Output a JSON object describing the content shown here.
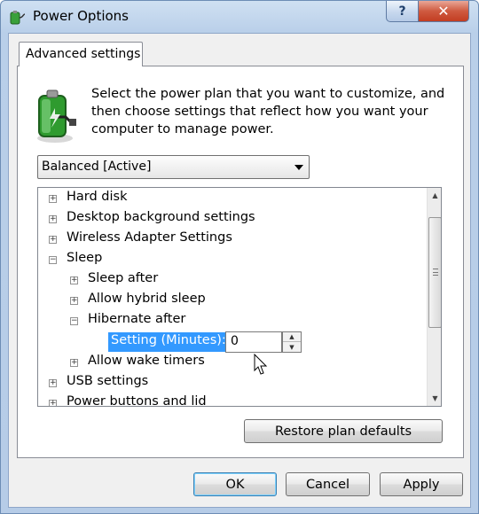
{
  "window": {
    "title": "Power Options",
    "help_label": "?",
    "close_label": "✕"
  },
  "tab": {
    "label": "Advanced settings"
  },
  "intro": {
    "line1": "Select the power plan that you want to customize, and",
    "line2": "then choose settings that reflect how you want your",
    "line3": "computer to manage power."
  },
  "plan_select": {
    "value": "Balanced [Active]"
  },
  "tree": {
    "items": [
      {
        "label": "Hard disk",
        "expander": "+"
      },
      {
        "label": "Desktop background settings",
        "expander": "+"
      },
      {
        "label": "Wireless Adapter Settings",
        "expander": "+"
      },
      {
        "label": "Sleep",
        "expander": "−"
      },
      {
        "label": "Sleep after",
        "expander": "+"
      },
      {
        "label": "Allow hybrid sleep",
        "expander": "+"
      },
      {
        "label": "Hibernate after",
        "expander": "−"
      },
      {
        "label": "Allow wake timers",
        "expander": "+"
      },
      {
        "label": "USB settings",
        "expander": "+"
      },
      {
        "label": "Power buttons and lid",
        "expander": "+"
      }
    ],
    "setting_label": "Setting (Minutes):",
    "setting_value": "0"
  },
  "buttons": {
    "restore": "Restore plan defaults",
    "ok": "OK",
    "cancel": "Cancel",
    "apply": "Apply"
  },
  "icons": {
    "title": "power-options-icon",
    "intro": "battery-plug-icon",
    "cursor": "mouse-pointer-icon"
  }
}
